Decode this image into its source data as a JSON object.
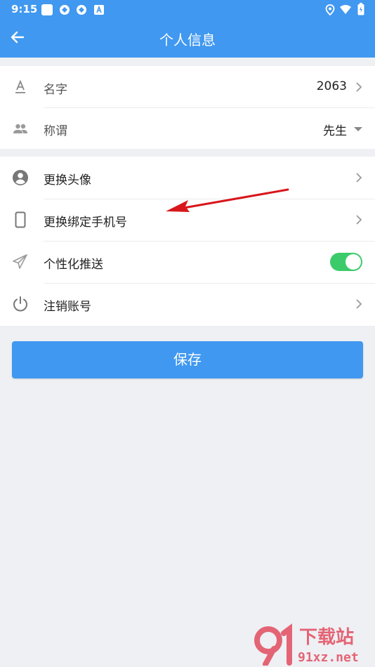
{
  "status_bar": {
    "time": "9:15"
  },
  "app_bar": {
    "title": "个人信息"
  },
  "profile": {
    "name": {
      "label": "名字",
      "value": "2063"
    },
    "salutation": {
      "label": "称谓",
      "value": "先生"
    }
  },
  "settings": [
    {
      "label": "更换头像"
    },
    {
      "label": "更换绑定手机号"
    },
    {
      "label": "个性化推送",
      "toggle_on": true
    },
    {
      "label": "注销账号"
    }
  ],
  "save_button": {
    "label": "保存"
  },
  "watermark": {
    "text_top": "下载站",
    "text_bottom": "91xz.net"
  }
}
